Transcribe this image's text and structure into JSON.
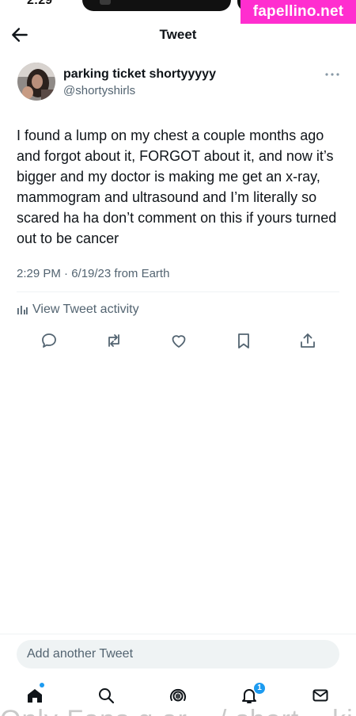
{
  "status": {
    "time": "2:29"
  },
  "watermark": {
    "text": "fapellino.net"
  },
  "header": {
    "title": "Tweet"
  },
  "tweet": {
    "display_name": "parking ticket shortyyyyy",
    "handle": "@shortyshirls",
    "text": "I found a lump on my chest a couple months ago and forgot about it, FORGOT about it, and now it’s bigger and my doctor is making me get an x-ray, mammogram and ultrasound and I’m literally so scared ha ha don’t comment on this if yours turned out to be cancer",
    "meta": "2:29 PM · 6/19/23 from Earth",
    "activity_label": "View Tweet activity"
  },
  "compose": {
    "placeholder": "Add another Tweet"
  },
  "nav": {
    "notifications_badge": "1"
  },
  "ghost_text": "Only Fans g ar... / short... ki...",
  "colors": {
    "accent": "#1d9bf0",
    "secondary_text": "#536471",
    "watermark": "#ff2ecf"
  },
  "icons": [
    "back-arrow-icon",
    "more-icon",
    "reply-icon",
    "retweet-icon",
    "like-icon",
    "bookmark-icon",
    "share-icon",
    "bar-chart-icon",
    "home-icon",
    "search-icon",
    "spaces-icon",
    "bell-icon",
    "mail-icon"
  ]
}
